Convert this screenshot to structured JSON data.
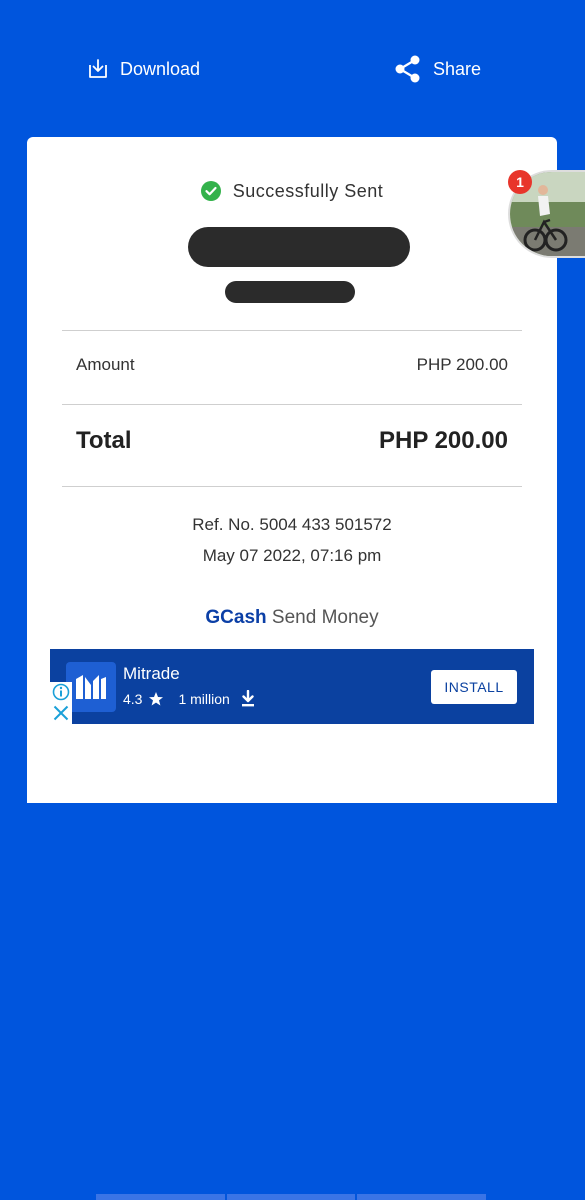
{
  "actions": {
    "download_label": "Download",
    "share_label": "Share"
  },
  "receipt": {
    "status": "Successfully Sent",
    "amount_label": "Amount",
    "amount_value": "PHP 200.00",
    "total_label": "Total",
    "total_value": "PHP 200.00",
    "ref": "Ref. No. 5004 433 501572",
    "datetime": "May 07 2022, 07:16 pm",
    "brand_name": "GCash",
    "brand_service": "Send Money"
  },
  "ad": {
    "app_name": "Mitrade",
    "rating": "4.3",
    "installs": "1 million",
    "install_label": "INSTALL",
    "icons": [
      "info-icon",
      "close-icon",
      "star-icon",
      "download-arrow-icon"
    ]
  },
  "chat_head": {
    "badge_count": "1"
  },
  "colors": {
    "background": "#0055dd",
    "ad_background": "#0b41a0",
    "brand_blue": "#0b3fa6",
    "success_green": "#33b24b",
    "badge_red": "#e8352b"
  }
}
